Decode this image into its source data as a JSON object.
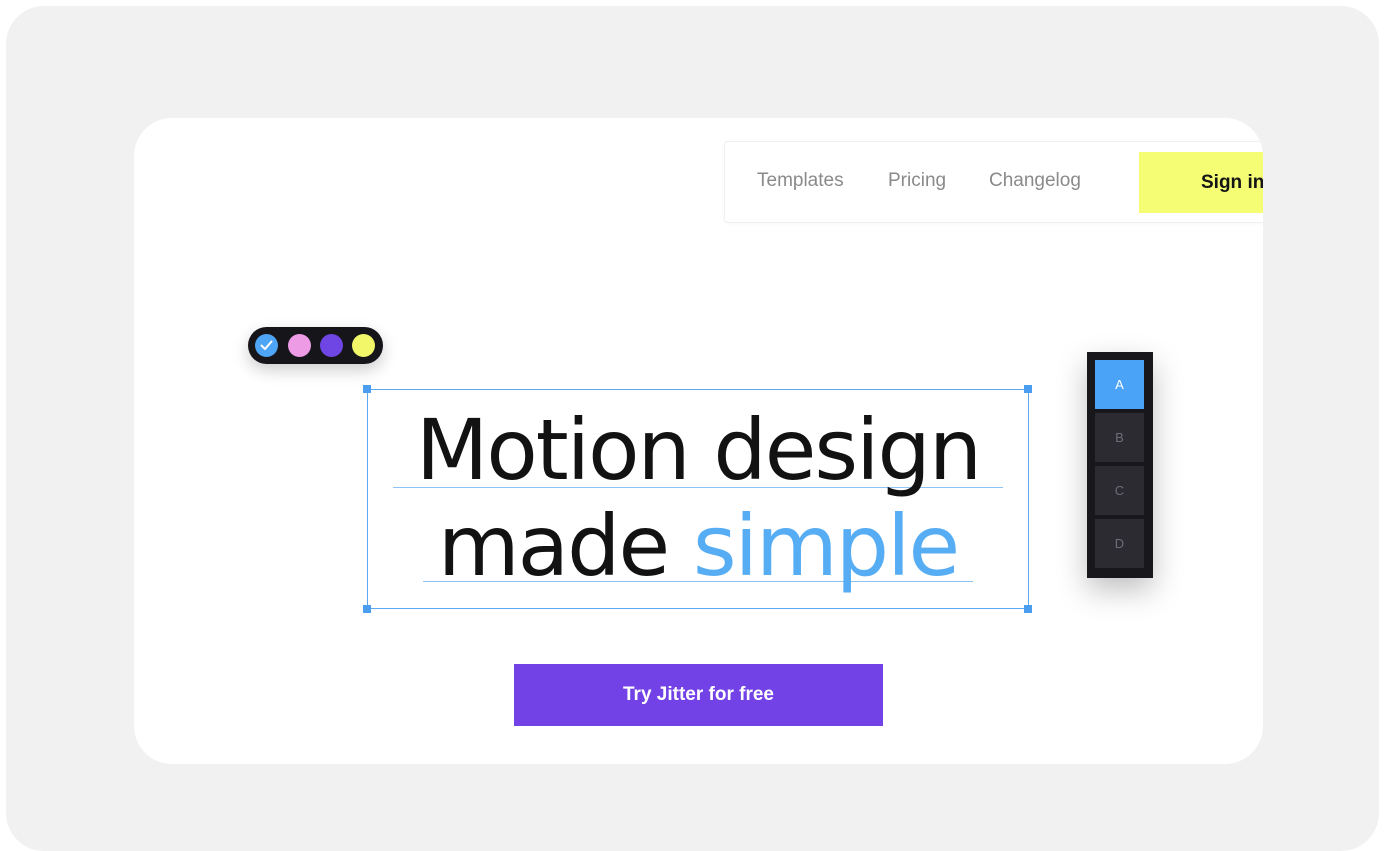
{
  "nav": {
    "links": [
      "Templates",
      "Pricing",
      "Changelog"
    ],
    "signin_label": "Sign in"
  },
  "palette": {
    "colors": [
      "#4ea4f5",
      "#ee9be6",
      "#6f45e4",
      "#f2f76a"
    ],
    "selected_index": 0,
    "selected_icon": "check-icon"
  },
  "hero": {
    "line1": "Motion design",
    "line2_plain": "made",
    "line2_accent": "simple"
  },
  "layers_panel": {
    "items": [
      "A",
      "B",
      "C",
      "D"
    ],
    "active": "A"
  },
  "cta": {
    "label": "Try Jitter for free"
  },
  "colors": {
    "accent_blue": "#57adf4",
    "cta_purple": "#7242e6",
    "signin_yellow": "#f4fd74"
  }
}
